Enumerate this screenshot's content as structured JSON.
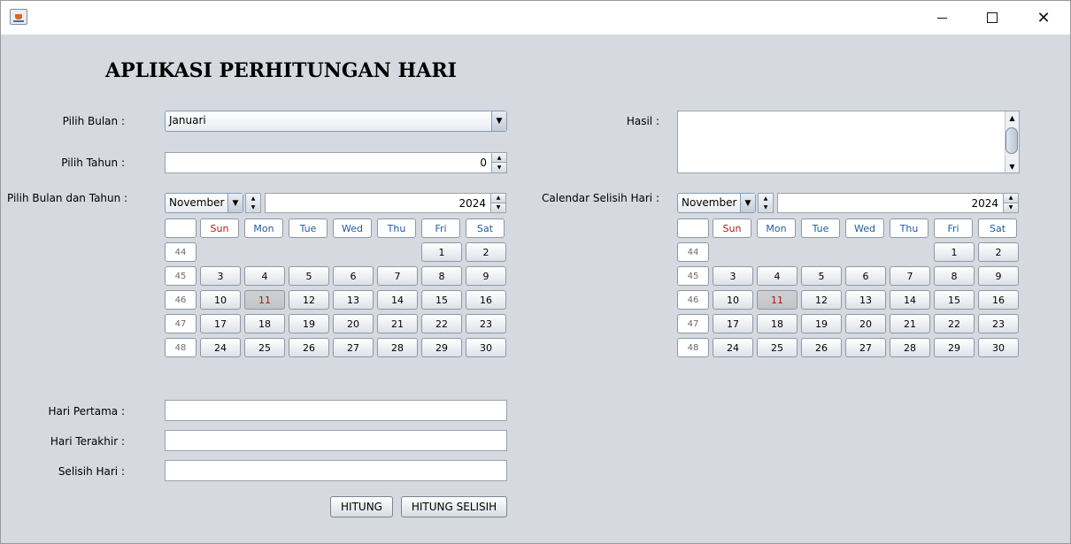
{
  "window": {
    "min_glyph": "",
    "close_glyph": "✕"
  },
  "app": {
    "title": "APLIKASI PERHITUNGAN HARI"
  },
  "form": {
    "pilih_bulan_label": "Pilih Bulan :",
    "pilih_bulan_value": "Januari",
    "pilih_tahun_label": "Pilih Tahun :",
    "pilih_tahun_value": "0",
    "pilih_bulan_tahun_label": "Pilih Bulan dan Tahun :",
    "hasil_label": "Hasil :",
    "calendar_selisih_label": "Calendar Selisih Hari :",
    "hari_pertama_label": "Hari Pertama :",
    "hari_terakhir_label": "Hari Terakhir :",
    "selisih_hari_label": "Selisih Hari :",
    "hitung_button": "HITUNG",
    "hitung_selisih_button": "HITUNG SELISIH"
  },
  "calendar": {
    "month": "November",
    "year": "2024",
    "weekdays": [
      "Sun",
      "Mon",
      "Tue",
      "Wed",
      "Thu",
      "Fri",
      "Sat"
    ],
    "weeks": [
      {
        "week": "44",
        "days": [
          "",
          "",
          "",
          "",
          "",
          "1",
          "2"
        ]
      },
      {
        "week": "45",
        "days": [
          "3",
          "4",
          "5",
          "6",
          "7",
          "8",
          "9"
        ]
      },
      {
        "week": "46",
        "days": [
          "10",
          "11",
          "12",
          "13",
          "14",
          "15",
          "16"
        ]
      },
      {
        "week": "47",
        "days": [
          "17",
          "18",
          "19",
          "20",
          "21",
          "22",
          "23"
        ]
      },
      {
        "week": "48",
        "days": [
          "24",
          "25",
          "26",
          "27",
          "28",
          "29",
          "30"
        ]
      }
    ],
    "today": "11"
  },
  "icons": {
    "app": "java-cup-icon",
    "dropdown": "▼",
    "spin_up": "▲",
    "spin_down": "▼"
  },
  "colors": {
    "weekday_header": "#1f5b9a",
    "sunday_header": "#b01515",
    "today_text": "#b01515",
    "window_bg": "#d6d9df"
  }
}
